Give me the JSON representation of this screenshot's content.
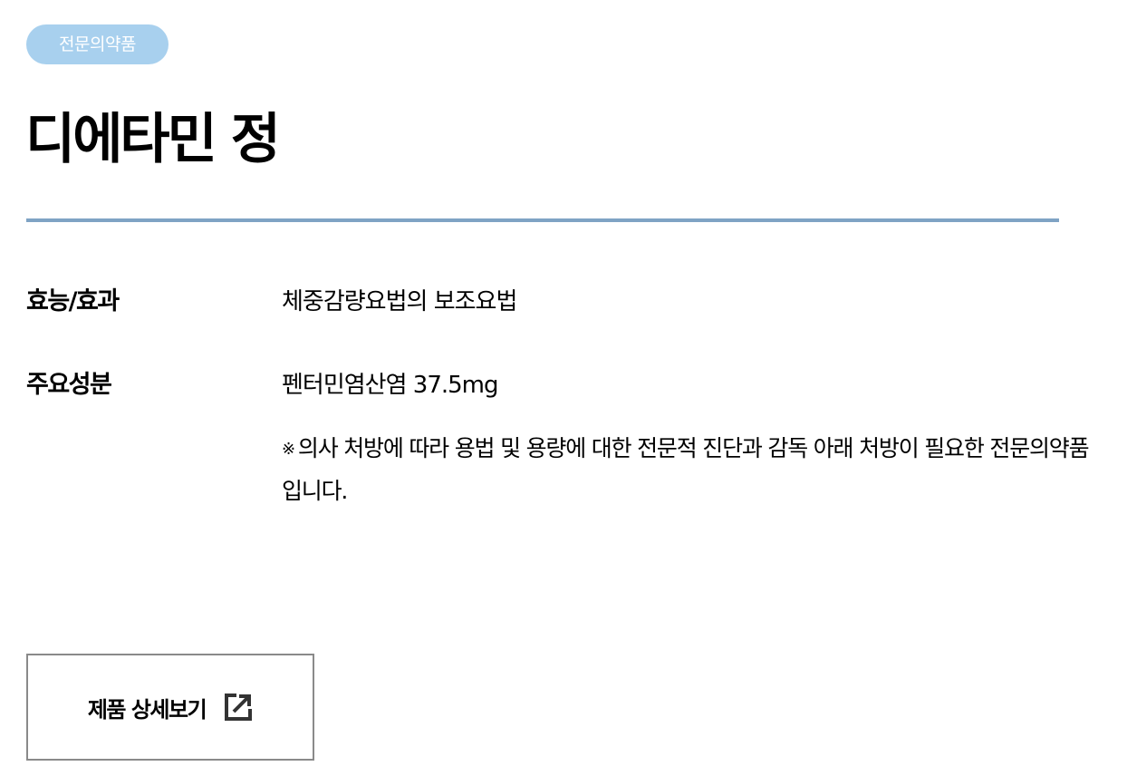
{
  "badge": {
    "label": "전문의약품",
    "color": "#a8d0ee"
  },
  "product": {
    "name": "디에타민 정"
  },
  "divider_color": "#7fa3c4",
  "info": [
    {
      "label": "효능/효과",
      "value": "체중감량요법의 보조요법"
    },
    {
      "label": "주요성분",
      "value": "펜터민염산염 37.5mg"
    }
  ],
  "note": {
    "mark": "※",
    "text": "의사 처방에 따라 용법 및 용량에 대한 전문적 진단과 감독 아래 처방이 필요한 전문의약품입니다."
  },
  "detail_button": {
    "label": "제품 상세보기",
    "icon": "external-link-icon"
  }
}
